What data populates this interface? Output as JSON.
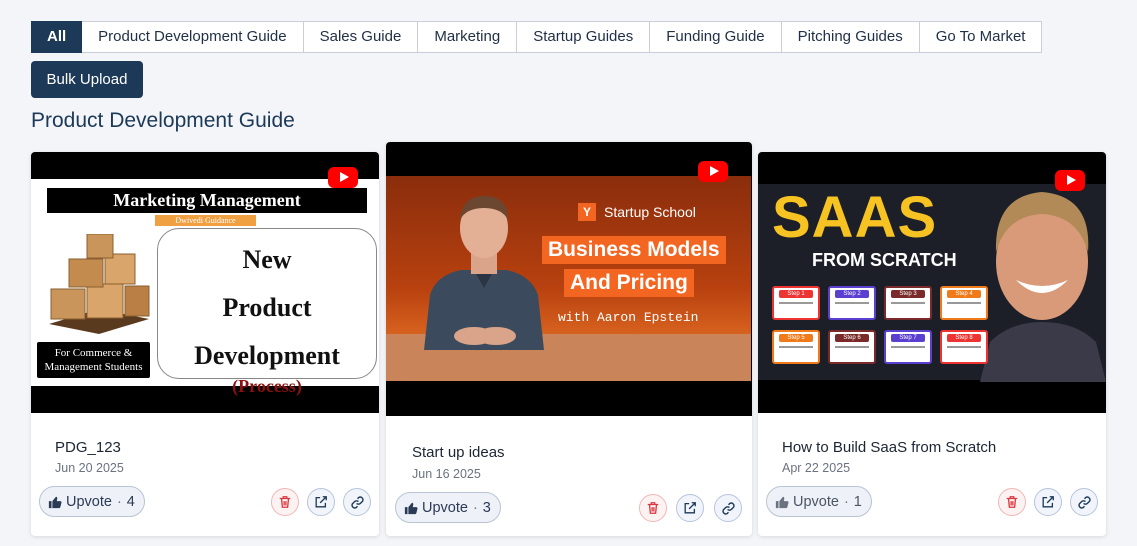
{
  "tabs": [
    "All",
    "Product Development Guide",
    "Sales Guide",
    "Marketing",
    "Startup Guides",
    "Funding Guide",
    "Pitching Guides",
    "Go To Market"
  ],
  "active_tab": "All",
  "bulk_upload_label": "Bulk Upload",
  "section_title": "Product Development Guide",
  "cards": [
    {
      "title": "PDG_123",
      "date": "Jun 20 2025",
      "upvote_label": "Upvote",
      "upvote_count": "4",
      "thumbnail": {
        "bar": "Marketing Management",
        "tag": "Dwivedi Guidance",
        "line1": "New",
        "line2": "Product",
        "line3": "Development",
        "line4": "(Process)",
        "note": "For Commerce & Management Students"
      }
    },
    {
      "title": "Start up ideas",
      "date": "Jun 16 2025",
      "upvote_label": "Upvote",
      "upvote_count": "3",
      "thumbnail": {
        "brand_letter": "Y",
        "brand": "Startup School",
        "line1": "Business Models",
        "line2": "And Pricing",
        "presenter": "with Aaron Epstein"
      }
    },
    {
      "title": "How to Build SaaS from Scratch",
      "date": "Apr 22 2025",
      "upvote_label": "Upvote",
      "upvote_count": "1",
      "thumbnail": {
        "big": "SAAS",
        "sub": "FROM SCRATCH",
        "steps": [
          "Step 1",
          "Step 2",
          "Step 3",
          "Step 4",
          "Step 5",
          "Step 6",
          "Step 7",
          "Step 8"
        ]
      }
    }
  ],
  "colors": {
    "primary": "#1c3958",
    "youtube": "#ff0000",
    "delete": "#d9363e",
    "startup_orange": "#f26622",
    "saas_yellow": "#f7c323"
  }
}
